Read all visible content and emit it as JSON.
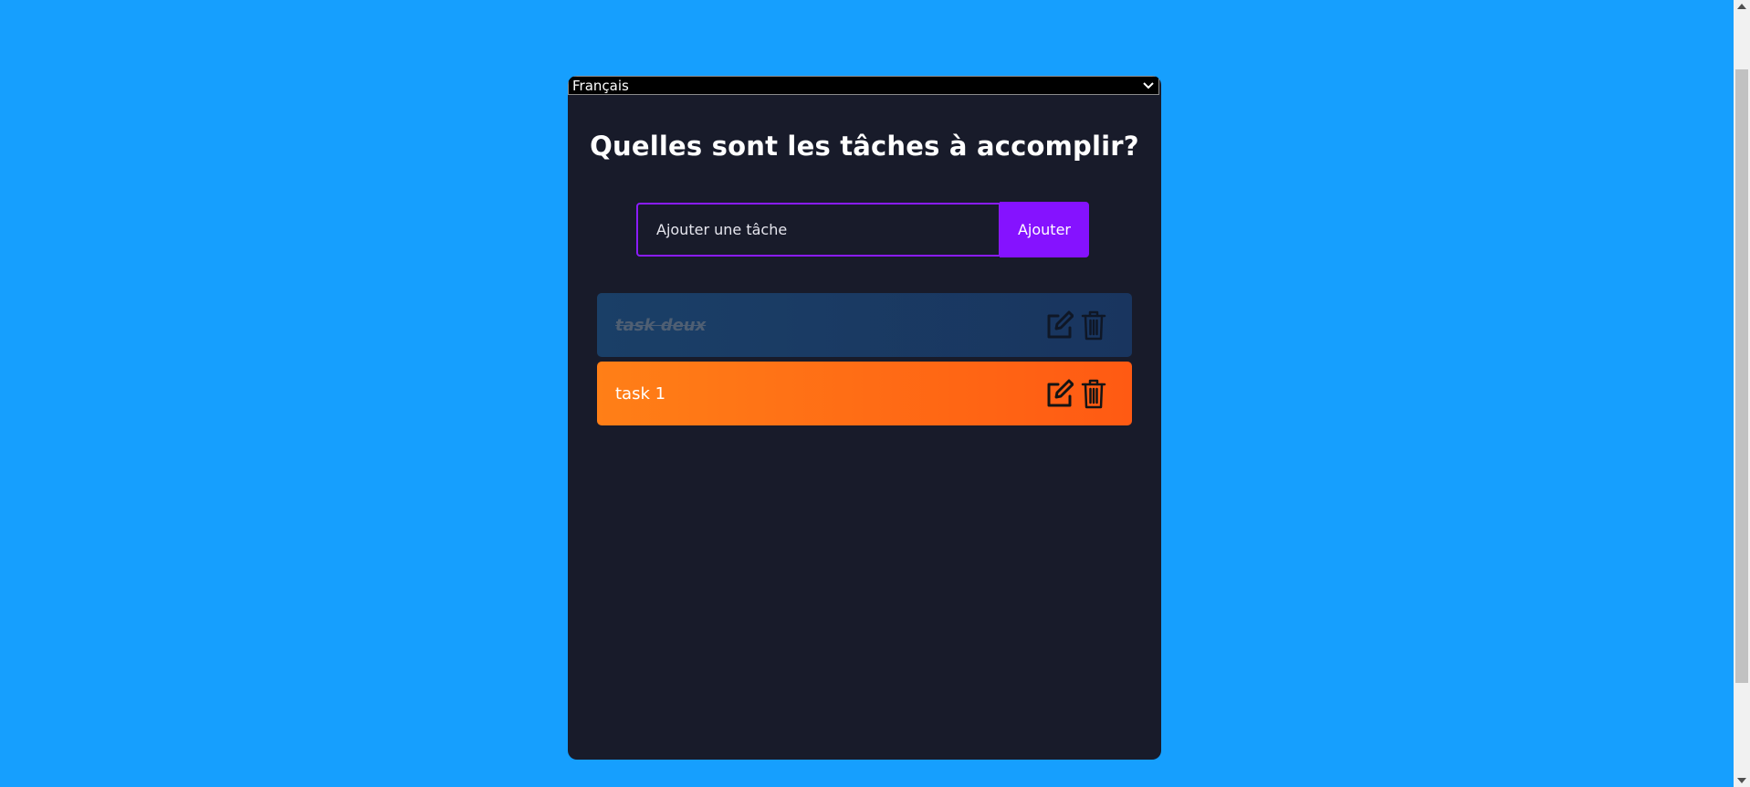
{
  "language_select": {
    "selected": "Français"
  },
  "app": {
    "title": "Quelles sont les tâches à accomplir?"
  },
  "form": {
    "input_placeholder": "Ajouter une tâche",
    "input_value": "",
    "add_button_label": "Ajouter"
  },
  "todos": [
    {
      "label": "task deux",
      "completed": true
    },
    {
      "label": "task 1",
      "completed": false
    }
  ],
  "icons": {
    "edit": "edit-icon",
    "delete": "trash-icon",
    "dropdown": "chevron-down-icon"
  },
  "colors": {
    "background": "#169ffe",
    "panel": "#181b2a",
    "accent": "#8512ff",
    "completed_task": "#1a3f67",
    "active_task": "#ff7f17"
  }
}
